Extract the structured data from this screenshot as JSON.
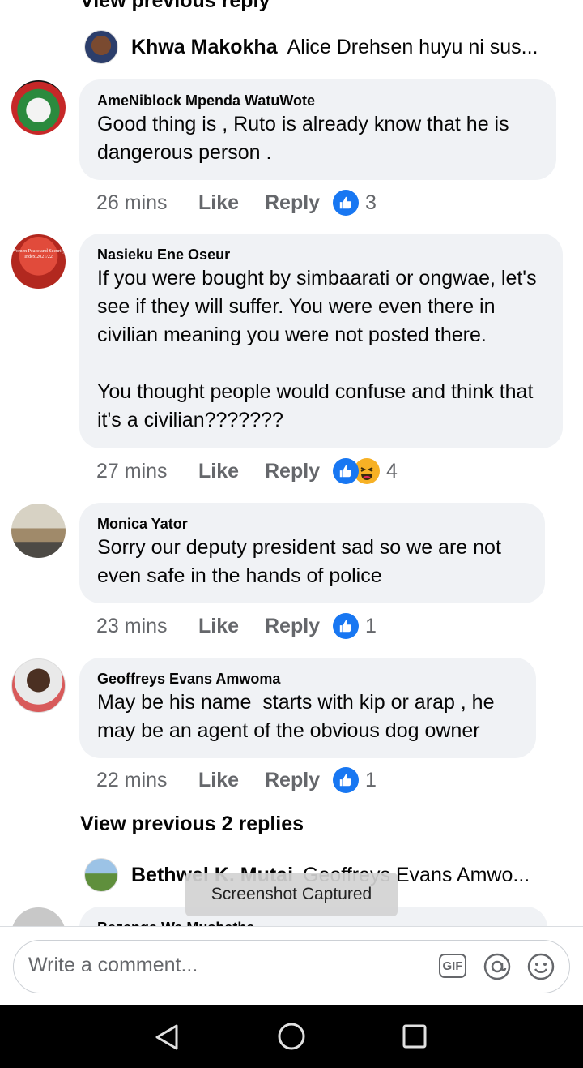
{
  "top": {
    "view_reply_label": "View previous reply"
  },
  "reply_preview_1": {
    "name": "Khwa Makokha",
    "snippet": "Alice Drehsen huyu ni sus..."
  },
  "comments": [
    {
      "author": "AmeNiblock Mpenda WatuWote",
      "text": "Good thing is , Ruto is already know that he is dangerous person .",
      "time": "26 mins",
      "like": "Like",
      "reply": "Reply",
      "count": "3",
      "reactions": [
        "like-icon"
      ]
    },
    {
      "author": "Nasieku Ene Oseur",
      "text": "If you were bought by simbaarati or ongwae, let's see if they will suffer. You were even there in civilian meaning you were not posted there.\n\nYou thought people would confuse and think that it's a civilian???????",
      "time": "27 mins",
      "like": "Like",
      "reply": "Reply",
      "count": "4",
      "reactions": [
        "like-icon",
        "haha-icon"
      ],
      "avatar_text": "Women Peace and Security Index 2021/22"
    },
    {
      "author": "Monica Yator",
      "text": "Sorry our deputy president sad so we are not even safe in the hands of police",
      "time": "23 mins",
      "like": "Like",
      "reply": "Reply",
      "count": "1",
      "reactions": [
        "like-icon"
      ]
    },
    {
      "author": "Geoffreys Evans Amwoma",
      "text": "May be his name  starts with kip or arap , he may be an agent of the obvious dog owner",
      "time": "22 mins",
      "like": "Like",
      "reply": "Reply",
      "count": "1",
      "reactions": [
        "like-icon"
      ]
    }
  ],
  "view_more": {
    "label": "View previous 2 replies"
  },
  "reply_preview_2": {
    "name": "Bethwel K. Mutai",
    "snippet": "Geoffreys Evans Amwo..."
  },
  "partial_comment": {
    "author": "Bezenga Wa Mushatha"
  },
  "toast": {
    "label": "Screenshot Captured"
  },
  "composer": {
    "placeholder": "Write a comment...",
    "gif_label": "GIF"
  },
  "colors": {
    "like_blue": "#1877f2",
    "haha_yellow": "#f7b125",
    "bubble_bg": "#f0f2f5",
    "meta_gray": "#65676b"
  },
  "icons": [
    "like-icon",
    "haha-icon",
    "gif-icon",
    "mention-icon",
    "emoji-icon",
    "back-icon",
    "home-icon",
    "recents-icon"
  ]
}
